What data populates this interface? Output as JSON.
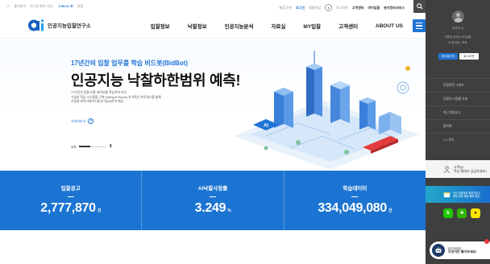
{
  "topbar": {
    "left_links": [
      "즐겨찾기",
      "로그인 유지 시간 :",
      "2:58:11 초",
      "연장"
    ],
    "right_links": [
      "제휴 문의",
      "이전 ",
      "로그인",
      "회원가입",
      "로그아웃",
      "고객센터",
      "아이디 찾기"
    ],
    "site": "마이입찰",
    "account": "분석정보서비스"
  },
  "header": {
    "logo_text": "인공지능입찰연구소",
    "nav": [
      "입찰정보",
      "낙찰정보",
      "인공지능분석",
      "자료실",
      "MY입찰",
      "고객센터",
      "ABOUT US"
    ]
  },
  "hero": {
    "subtitle": "17년간의 입찰 업무를 학습 비드봇(BidBot)",
    "title": "인공지능 낙찰하한범위 예측!",
    "desc": [
      "17년간의 입찰/낙찰 데이터를 학습하여 지식",
      "기능한 학습 시스템을 구축 (Using AI Boost) 추가적인 프로세스를 통해",
      "조달청 데이터베이스를 분석(AI)하여 제공"
    ],
    "more": "자세히보기",
    "slider": {
      "current": "1/3",
      "pause": "II"
    }
  },
  "stats": [
    {
      "label": "입찰공고",
      "value": "2,777,870",
      "unit": "건"
    },
    {
      "label": "AI낙찰사정률",
      "value": "3.249",
      "unit": "%"
    },
    {
      "label": "학습데이터",
      "value": "334,049,080",
      "unit": "건"
    }
  ],
  "sidebar": {
    "greeting": "관리자 님",
    "greeting_lines": [
      "이용권 관리는 MY입찰",
      "AI 분석권 : 보유"
    ],
    "buttons": {
      "mypage": "마이페이지",
      "logout": "로그아웃"
    },
    "menu": [
      "투찰관련 그래프",
      "입찰자 사정률 추세",
      "최근 열람공고",
      "찜목록",
      "1:1 문의"
    ],
    "question": [
      "고객님!",
      "학습 형태가 궁금하세요?"
    ],
    "banner": [
      "신규 입찰정보 회원가입시",
      "최대 무료 체험 혜택 제공!"
    ],
    "chat": {
      "line1": "비드봇에게",
      "line2": "무엇이든 물어보세요!"
    }
  }
}
